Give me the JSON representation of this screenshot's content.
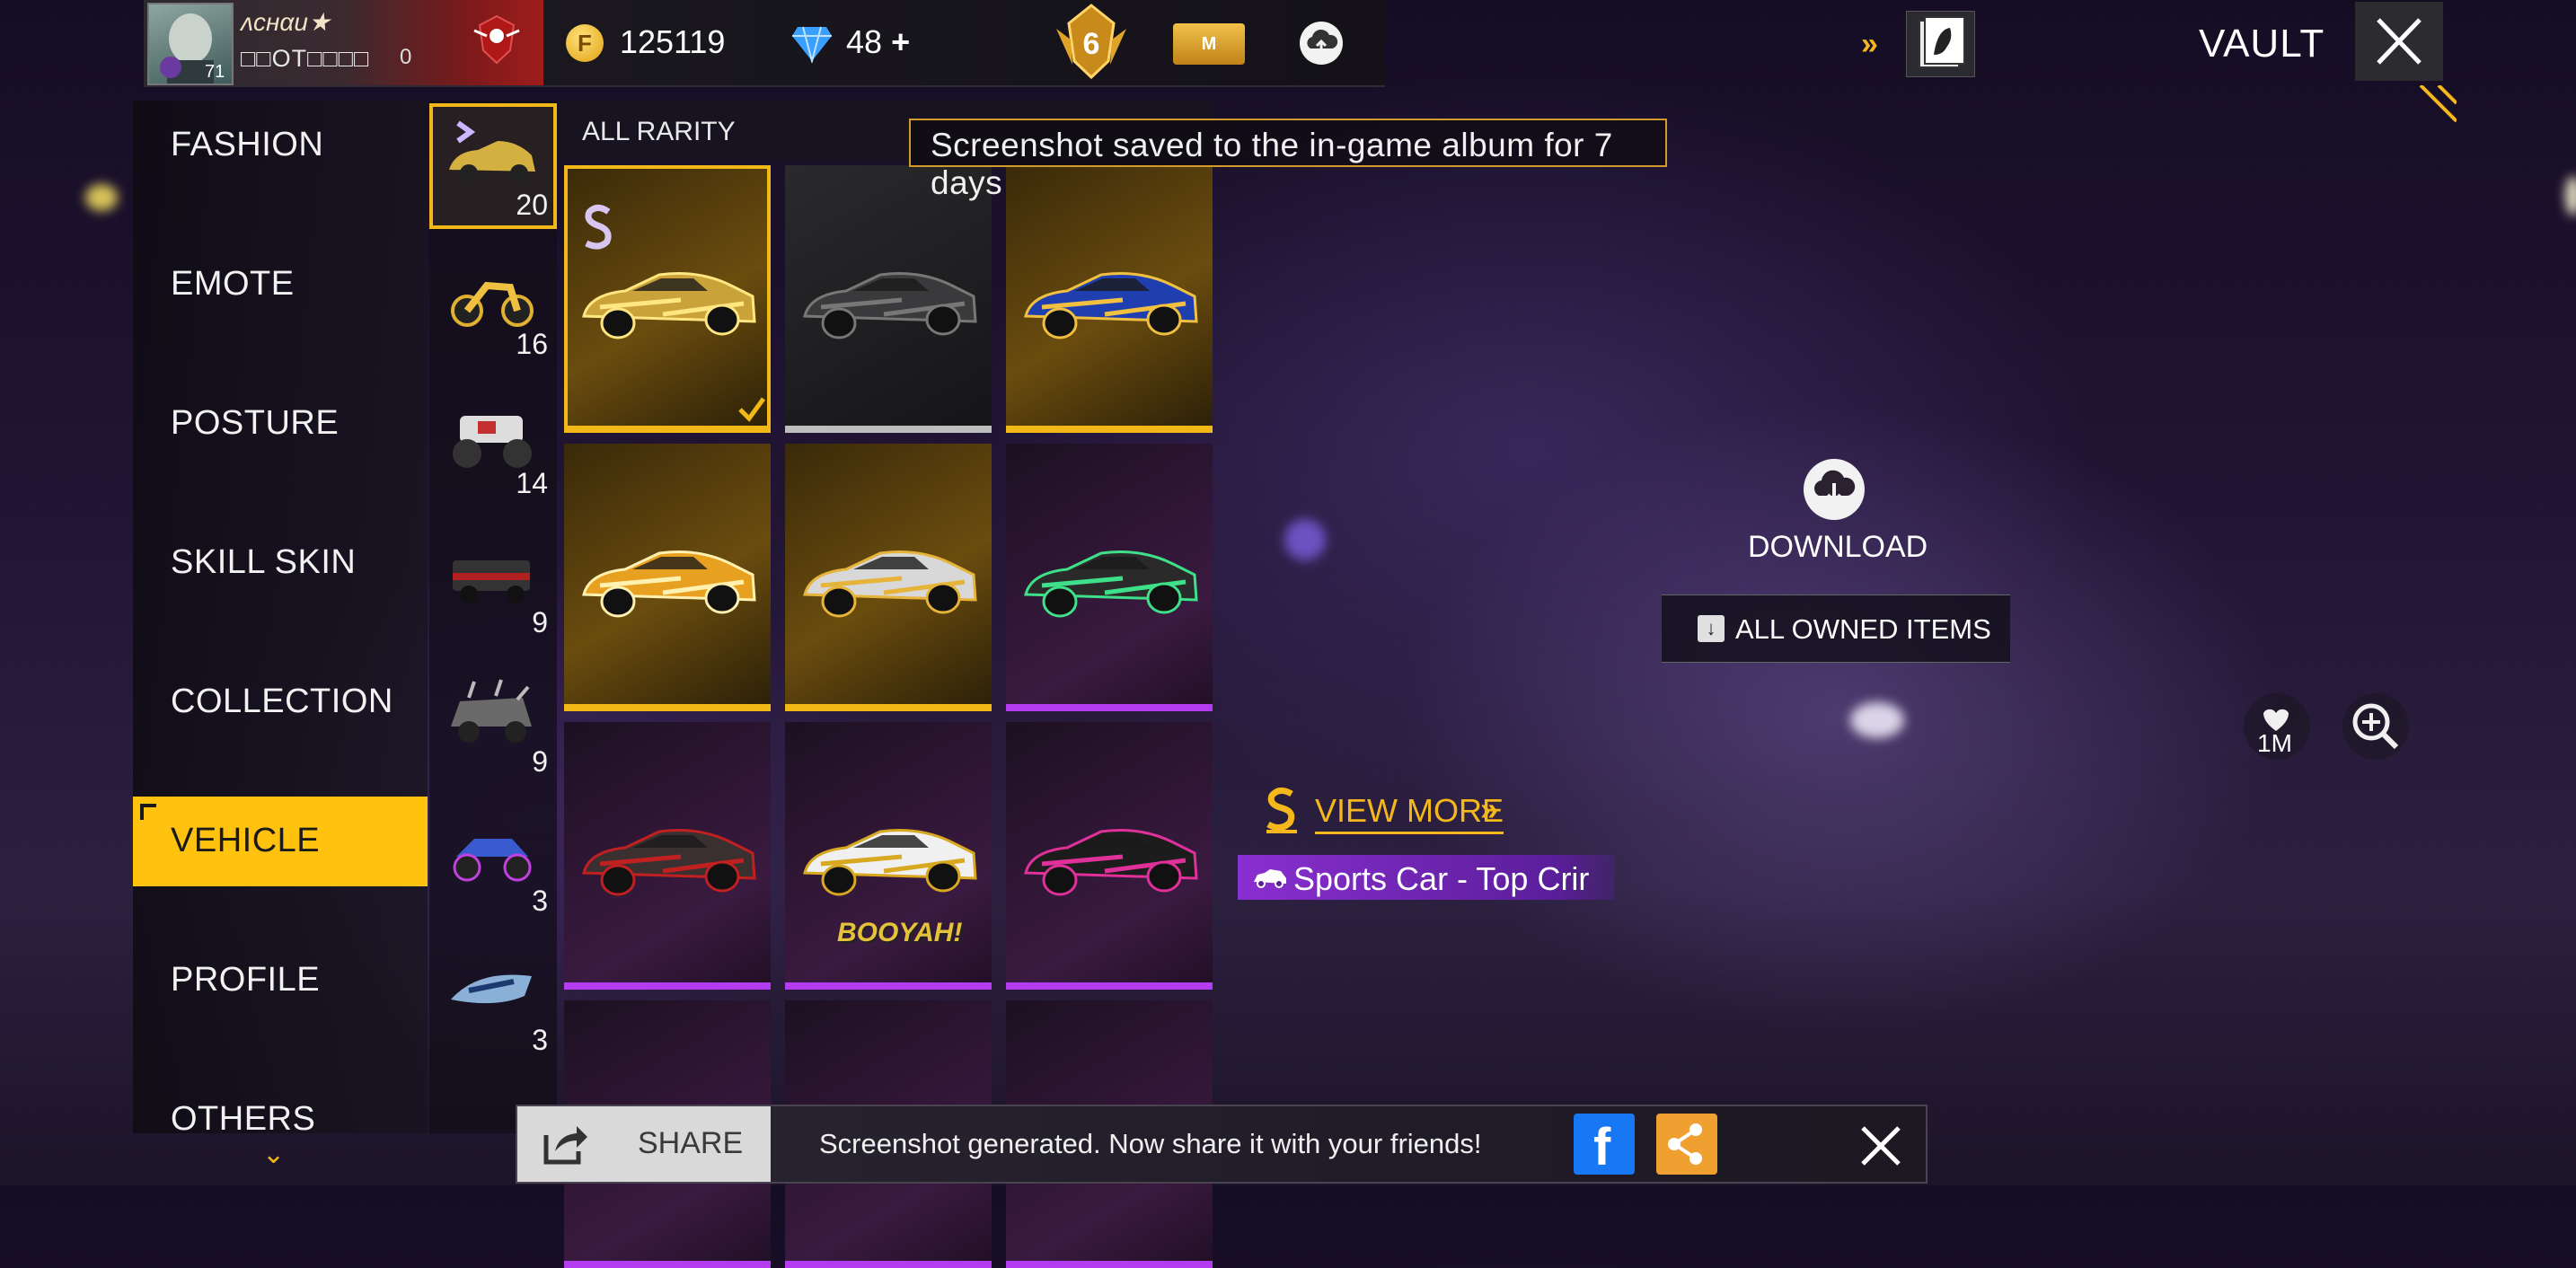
{
  "player": {
    "name": "ʌcнαи★",
    "sub_label": "□□OT□□□□",
    "number": "0",
    "level": "71"
  },
  "currency": {
    "gold": "125119",
    "diamonds": "48",
    "diamonds_add": "+"
  },
  "header": {
    "rank_number": "6",
    "membership_label": "M",
    "title": "VAULT"
  },
  "left_menu": {
    "items": [
      {
        "label": "FASHION"
      },
      {
        "label": "EMOTE"
      },
      {
        "label": "POSTURE"
      },
      {
        "label": "SKILL SKIN"
      },
      {
        "label": "COLLECTION"
      },
      {
        "label": "VEHICLE"
      },
      {
        "label": "PROFILE"
      },
      {
        "label": "OTHERS"
      }
    ],
    "active": "VEHICLE"
  },
  "categories": [
    {
      "count": "20",
      "icon": "sports-car-icon"
    },
    {
      "count": "16",
      "icon": "motorcycle-icon"
    },
    {
      "count": "14",
      "icon": "monster-truck-icon"
    },
    {
      "count": "9",
      "icon": "suv-icon"
    },
    {
      "count": "9",
      "icon": "armored-truck-icon"
    },
    {
      "count": "3",
      "icon": "atv-icon"
    },
    {
      "count": "3",
      "icon": "hoverbike-icon"
    }
  ],
  "grid": {
    "filter_label": "ALL RARITY",
    "tiles": [
      {
        "rarity": "gold",
        "selected": true,
        "body": "#c9a23a",
        "accent": "#ffe680"
      },
      {
        "rarity": "gray",
        "body": "#3a3a3c",
        "accent": "#777"
      },
      {
        "rarity": "gold",
        "body": "#1f3fb0",
        "accent": "#f2c040"
      },
      {
        "rarity": "gold",
        "body": "#e8a020",
        "accent": "#fff1b0"
      },
      {
        "rarity": "gold",
        "body": "#d8d8d8",
        "accent": "#e6b43a"
      },
      {
        "rarity": "purple",
        "body": "#2a2a2a",
        "accent": "#3fe08a"
      },
      {
        "rarity": "purple",
        "body": "#3a3030",
        "accent": "#c02020"
      },
      {
        "rarity": "purple",
        "body": "#f0f0f0",
        "accent": "#d8a820",
        "label": "BOOYAH!"
      },
      {
        "rarity": "purple",
        "body": "#1c1c1c",
        "accent": "#e0309a"
      },
      {
        "rarity": "purple",
        "body": "#403040",
        "accent": "#9aa"
      },
      {
        "rarity": "purple",
        "body": "#a01830",
        "accent": "#f05070"
      },
      {
        "rarity": "purple",
        "body": "#b04020",
        "accent": "#f0a040"
      }
    ]
  },
  "toast": {
    "message": "Screenshot saved to the in-game album for 7 days"
  },
  "right_panel": {
    "download_label": "DOWNLOAD",
    "all_owned_label": "ALL OWNED ITEMS",
    "like_count": "1M",
    "view_more_label": "VIEW MORE",
    "item_name": "Sports Car - Top Crir"
  },
  "share_bar": {
    "share_label": "SHARE",
    "message": "Screenshot generated. Now share it with your friends!"
  },
  "colors": {
    "accent": "#ffc20e",
    "gold_rarity": "#f2b817",
    "purple_rarity": "#b43cf0"
  }
}
